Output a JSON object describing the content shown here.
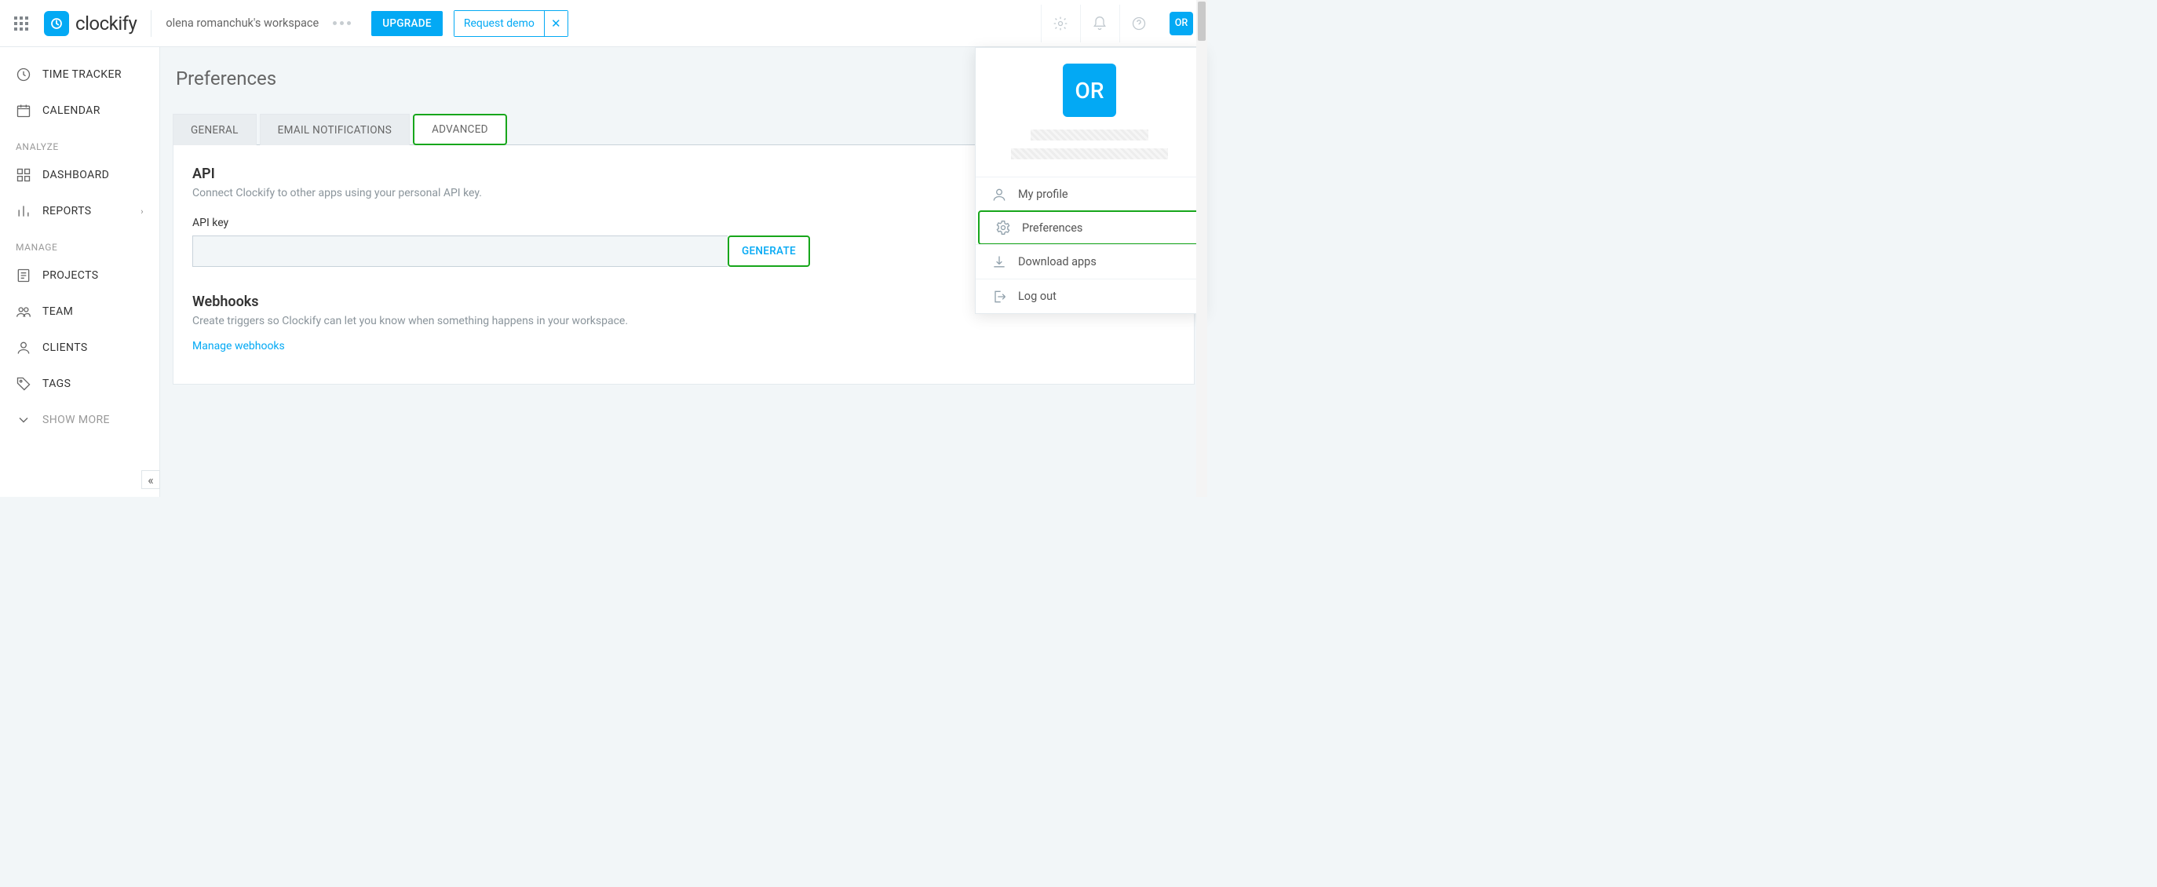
{
  "header": {
    "workspace": "olena romanchuk's workspace",
    "upgrade": "UPGRADE",
    "request_demo": "Request demo",
    "logo_text": "clockify",
    "avatar_initials": "OR"
  },
  "sidebar": {
    "items": [
      {
        "label": "TIME TRACKER"
      },
      {
        "label": "CALENDAR"
      }
    ],
    "section_analyze": "ANALYZE",
    "analyze": [
      {
        "label": "DASHBOARD"
      },
      {
        "label": "REPORTS"
      }
    ],
    "section_manage": "MANAGE",
    "manage": [
      {
        "label": "PROJECTS"
      },
      {
        "label": "TEAM"
      },
      {
        "label": "CLIENTS"
      },
      {
        "label": "TAGS"
      }
    ],
    "show_more": "SHOW MORE"
  },
  "page": {
    "title": "Preferences",
    "tabs": {
      "general": "GENERAL",
      "email": "EMAIL NOTIFICATIONS",
      "advanced": "ADVANCED"
    },
    "api": {
      "heading": "API",
      "sub": "Connect Clockify to other apps using your personal API key.",
      "field_label": "API key",
      "value": "",
      "generate": "GENERATE"
    },
    "webhooks": {
      "heading": "Webhooks",
      "sub": "Create triggers so Clockify can let you know when something happens in your workspace.",
      "link": "Manage webhooks"
    }
  },
  "dropdown": {
    "avatar": "OR",
    "my_profile": "My profile",
    "preferences": "Preferences",
    "download": "Download apps",
    "logout": "Log out"
  }
}
